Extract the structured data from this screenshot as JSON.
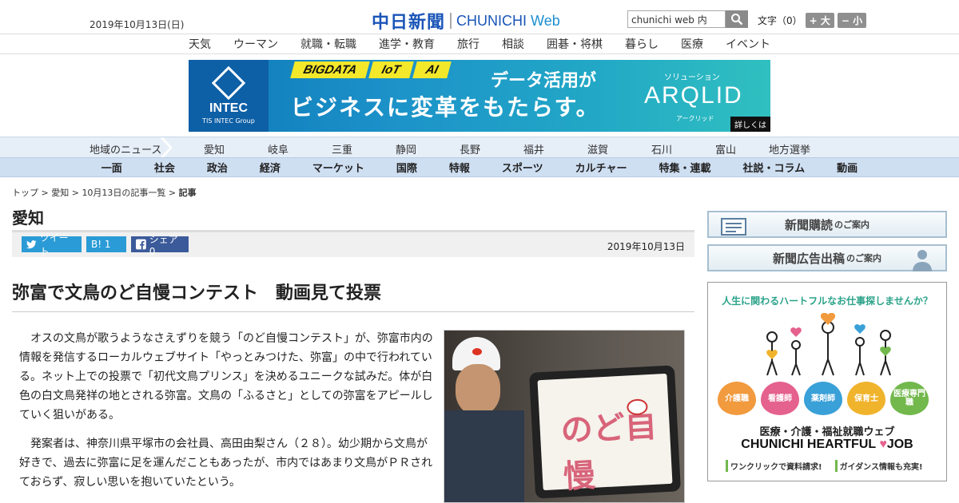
{
  "header": {
    "date": "2019年10月13日(日)",
    "logo_ja": "中日新聞",
    "logo_en_1": "CHUNICHI",
    "logo_en_2": "Web",
    "search_value": "chunichi web 内",
    "font_label": "文字（0）",
    "font_plus": "+ 大",
    "font_minus": "− 小"
  },
  "category_nav": [
    "天気",
    "ウーマン",
    "就職・転職",
    "進学・教育",
    "旅行",
    "相談",
    "囲碁・将棋",
    "暮らし",
    "医療",
    "イベント"
  ],
  "banner": {
    "brand": "INTEC",
    "brand_sub": "TIS INTEC Group",
    "tags": [
      "BIGDATA",
      "IoT",
      "AI"
    ],
    "line1": "データ活用が",
    "line2": "ビジネスに変革をもたらす。",
    "solution": "ソリューション",
    "product": "ARQLID",
    "product_ja": "アークリッド",
    "more": "詳しくは"
  },
  "region_nav": {
    "title": "地域のニュース",
    "items": [
      "愛知",
      "岐阜",
      "三重",
      "静岡",
      "長野",
      "福井",
      "滋賀",
      "石川",
      "富山",
      "地方選挙"
    ]
  },
  "main_nav": [
    "一面",
    "社会",
    "政治",
    "経済",
    "マーケット",
    "国際",
    "特報",
    "スポーツ",
    "カルチャー",
    "特集・連載",
    "社説・コラム",
    "動画"
  ],
  "breadcrumb": {
    "items": [
      "トップ",
      "愛知",
      "10月13日の記事一覧"
    ],
    "sep": " > ",
    "current": "記事"
  },
  "section_title": "愛知",
  "share": {
    "tweet": "ツイート",
    "hatena": "B! 1",
    "facebook": "シェア 0",
    "date": "2019年10月13日"
  },
  "article": {
    "headline": "弥富で文鳥のど自慢コンテスト　動画見て投票",
    "paragraphs": [
      "オスの文鳥が歌うようなさえずりを競う「のど自慢コンテスト」が、弥富市内の情報を発信するローカルウェブサイト「やっとみつけた、弥富」の中で行われている。ネット上での投票で「初代文鳥プリンス」を決めるユニークな試みだ。体が白色の白文鳥発祥の地とされる弥富。文鳥の「ふるさと」としての弥富をアピールしていく狙いがある。",
      "発案者は、神奈川県平塚市の会社員、高田由梨さん（２８）。幼少期から文鳥が好きで、過去に弥富に足を運んだこともあったが、市内ではあまり文鳥がＰＲされておらず、寂しい思いを抱いていたという。"
    ],
    "photo_text": "のど自慢"
  },
  "sidebar": {
    "subscribe_main": "新聞購読",
    "subscribe_sub": "のご案内",
    "ad_main": "新聞広告出稿",
    "ad_sub": "のご案内",
    "ad": {
      "headline": "人生に関わるハートフルなお仕事探しませんか？",
      "roles": [
        "介護職",
        "看護師",
        "薬剤師",
        "保育士",
        "医療専門職"
      ],
      "title1": "医療・介護・福祉就職ウェブ",
      "title2a": "CHUNICHI HEARTFUL",
      "title2b": "JOB",
      "note1": "ワンクリックで資料請求!",
      "note2": "ガイダンス情報も充実!"
    }
  }
}
